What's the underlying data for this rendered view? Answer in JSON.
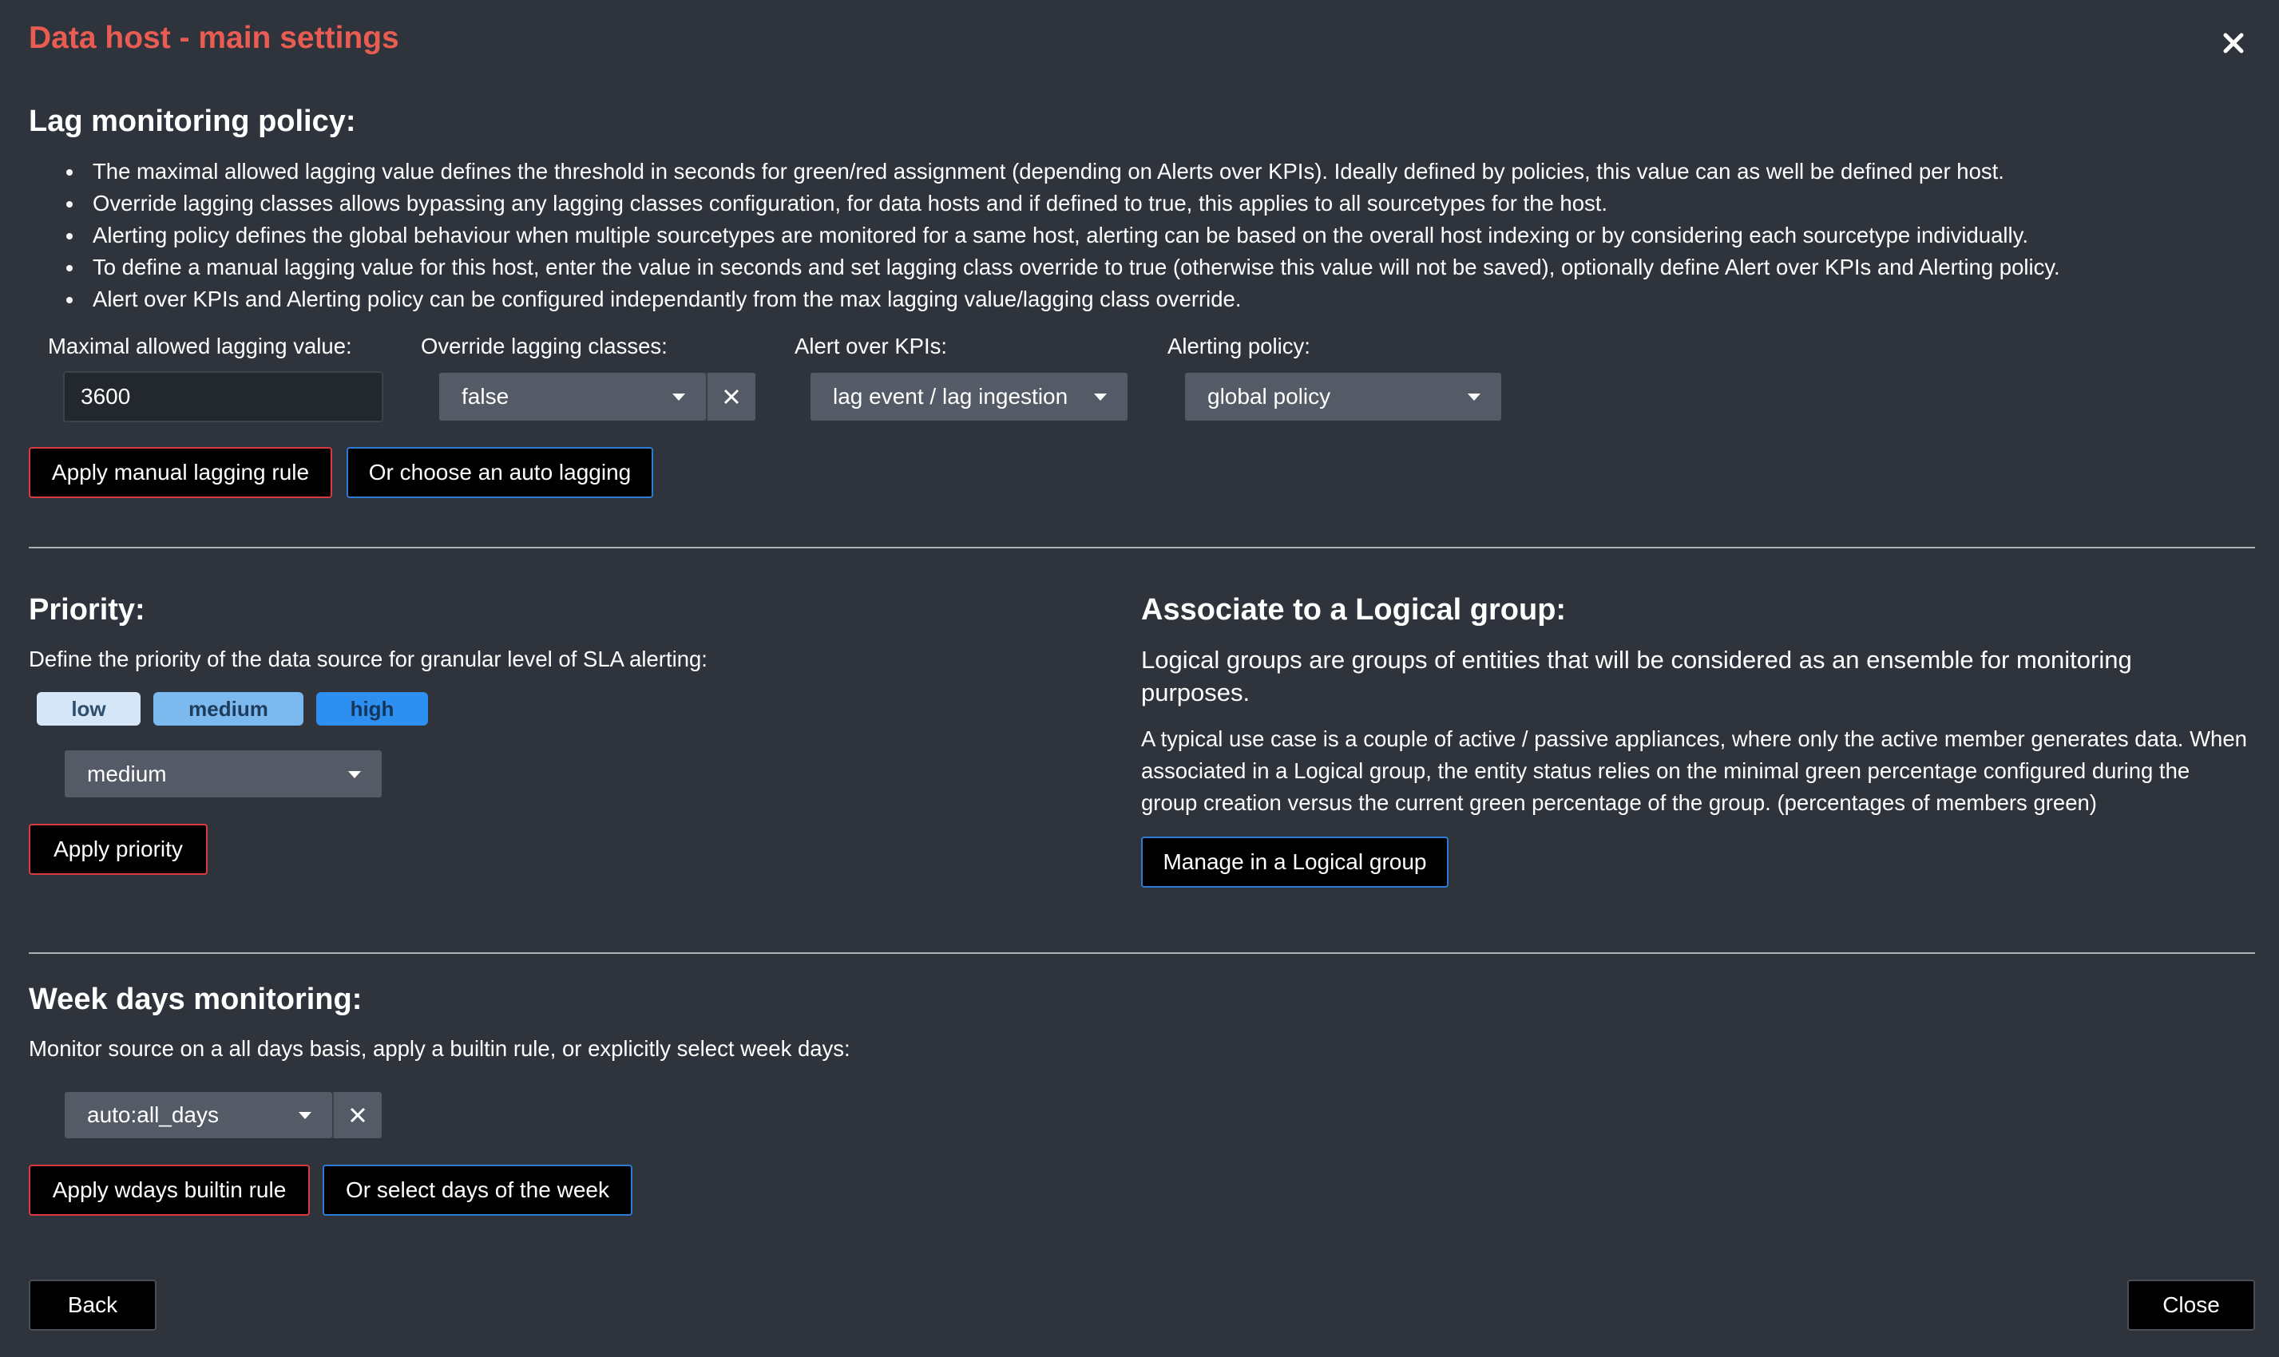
{
  "dialog": {
    "title": "Data host - main settings"
  },
  "lag": {
    "heading": "Lag monitoring policy:",
    "bullets": [
      "The maximal allowed lagging value defines the threshold in seconds for green/red assignment (depending on Alerts over KPIs). Ideally defined by policies, this value can as well be defined per host.",
      "Override lagging classes allows bypassing any lagging classes configuration, for data hosts and if defined to true, this applies to all sourcetypes for the host.",
      "Alerting policy defines the global behaviour when multiple sourcetypes are monitored for a same host, alerting can be based on the overall host indexing or by considering each sourcetype individually.",
      "To define a manual lagging value for this host, enter the value in seconds and set lagging class override to true (otherwise this value will not be saved), optionally define Alert over KPIs and Alerting policy.",
      "Alert over KPIs and Alerting policy can be configured independantly from the max lagging value/lagging class override."
    ],
    "max_label": "Maximal allowed lagging value:",
    "max_value": "3600",
    "override_label": "Override lagging classes:",
    "override_value": "false",
    "kpi_label": "Alert over KPIs:",
    "kpi_value": "lag event / lag ingestion",
    "policy_label": "Alerting policy:",
    "policy_value": "global policy",
    "apply_manual": "Apply manual lagging rule",
    "auto_lagging": "Or choose an auto lagging"
  },
  "priority": {
    "heading": "Priority:",
    "description": "Define the priority of the data source for granular level of SLA alerting:",
    "chips": [
      "low",
      "medium",
      "high"
    ],
    "selected": "medium",
    "apply": "Apply priority"
  },
  "logical": {
    "heading": "Associate to a Logical group:",
    "lead_1": "Logical groups are groups of entities that will be considered as an ensemble for monitoring",
    "lead_2": "purposes.",
    "detail_1": "A typical use case is a couple of active / passive appliances, where only the active member generates data. When",
    "detail_2": "associated in a Logical group, the entity status relies on the minimal green percentage configured during the",
    "detail_3": "group creation versus the current green percentage of the group. (percentages of members green)",
    "manage": "Manage in a Logical group"
  },
  "wdays": {
    "heading": "Week days monitoring:",
    "description": "Monitor source on a all days basis, apply a builtin rule, or explicitly select week days:",
    "selected": "auto:all_days",
    "apply": "Apply wdays builtin rule",
    "select_days": "Or select days of the week"
  },
  "footer": {
    "back": "Back",
    "close": "Close"
  },
  "colors": {
    "title": "#e85c52",
    "background": "#2e333c",
    "red_border": "#d9393f",
    "blue_border": "#2c7cd6"
  }
}
